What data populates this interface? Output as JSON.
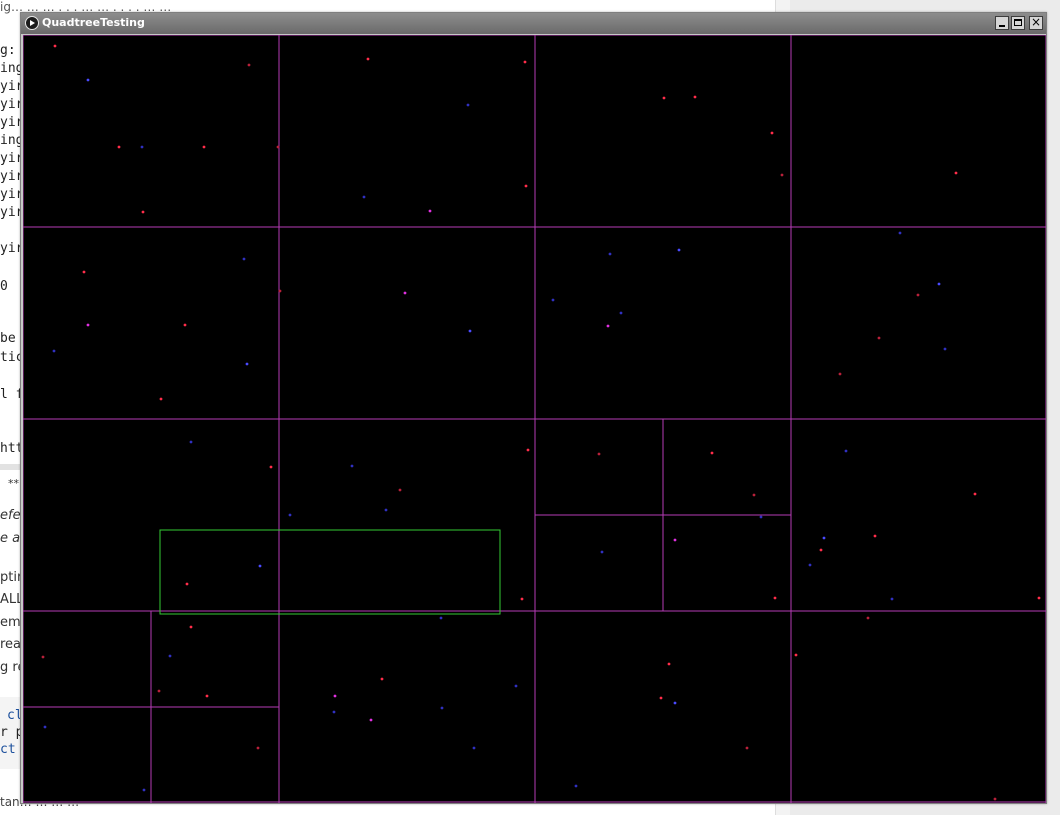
{
  "window": {
    "title": "QuadtreeTesting",
    "controls": {
      "minimize": "minimize-icon",
      "maximize": "maximize-icon",
      "close": "close-icon"
    }
  },
  "visualization": {
    "background": "#000000",
    "quadtree_color": "#b63bb6",
    "query_box_color": "#33cc33",
    "point_colors": {
      "red": "#ff2d4a",
      "blue": "#4a4aff",
      "magenta": "#e030e0",
      "dark_red": "#b8203a",
      "dark_blue": "#3030c0"
    }
  },
  "background_editor": {
    "top_line": "ig… … … . . . … … . . . . … …",
    "left_code_fragments": [
      "g:",
      "ing",
      "yir",
      "yir",
      "yir",
      "ing",
      "yir",
      "yir",
      "yir",
      "yir",
      "yir",
      "0",
      "be",
      "tic",
      "l f",
      "htt"
    ],
    "doc_fragments": [
      "**",
      "efer",
      "e a",
      "ptir",
      "ALL",
      "em",
      "rea",
      "g re"
    ],
    "code_block_fragments": [
      "cl",
      "r p",
      "ct"
    ],
    "bottom_line": "tan… … … …"
  }
}
